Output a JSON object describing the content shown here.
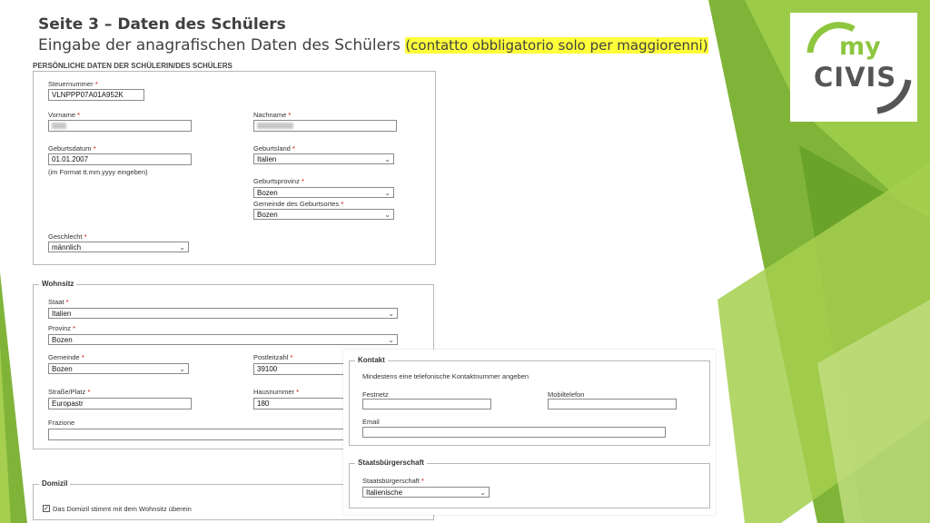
{
  "header": {
    "title": "Seite 3 – Daten des Schülers",
    "subtitle": "Eingabe der anagrafischen Daten des Schülers",
    "subtitle_note": "(contatto obbligatorio solo per maggiorenni)"
  },
  "logo": {
    "line1": "my",
    "line2": "CIVIS"
  },
  "personal": {
    "heading": "PERSÖNLICHE DATEN DER SCHÜLERIN/DES SCHÜLERS",
    "steuernummer": {
      "label": "Steuernummer",
      "value": "VLNPPP07A01A952K"
    },
    "vorname": {
      "label": "Vorname"
    },
    "nachname": {
      "label": "Nachname"
    },
    "geburtsdatum": {
      "label": "Geburtsdatum",
      "value": "01.01.2007",
      "hint": "(im Format tt.mm.yyyy eingeben)"
    },
    "geburtsland": {
      "label": "Geburtsland",
      "value": "Italien"
    },
    "geburtsprovinz": {
      "label": "Geburtsprovinz",
      "value": "Bozen"
    },
    "gemeinde_geburtsort": {
      "label": "Gemeinde des Geburtsortes",
      "value": "Bozen"
    },
    "geschlecht": {
      "label": "Geschlecht",
      "value": "männlich"
    }
  },
  "wohnsitz": {
    "legend": "Wohnsitz",
    "staat": {
      "label": "Staat",
      "value": "Italien"
    },
    "provinz": {
      "label": "Provinz",
      "value": "Bozen"
    },
    "gemeinde": {
      "label": "Gemeinde",
      "value": "Bozen"
    },
    "postleitzahl": {
      "label": "Postleitzahl",
      "value": "39100"
    },
    "strasse": {
      "label": "Straße/Platz",
      "value": "Europastr"
    },
    "hausnummer": {
      "label": "Hausnummer",
      "value": "180"
    },
    "frazione": {
      "label": "Frazione",
      "value": ""
    }
  },
  "domizil": {
    "legend": "Domizil",
    "checkbox_label": "Das Domizil stimmt mit dem Wohnsitz überein",
    "checked": true
  },
  "kontakt": {
    "legend": "Kontakt",
    "note": "Mindestens eine telefonische Kontaktnummer angeben",
    "festnetz": {
      "label": "Festnetz",
      "value": ""
    },
    "mobiltelefon": {
      "label": "Mobiltelefon",
      "value": ""
    },
    "email": {
      "label": "Email",
      "value": ""
    }
  },
  "staatsbuergerschaft": {
    "legend": "Staatsbürgerschaft",
    "label": "Staatsbürgerschaft",
    "value": "Italienische"
  },
  "required_marker": "*",
  "dropdown_glyph": "⌄",
  "colors": {
    "green_dark": "#6aa32a",
    "green_light": "#a6cf4f",
    "highlight": "#ffff3a"
  }
}
